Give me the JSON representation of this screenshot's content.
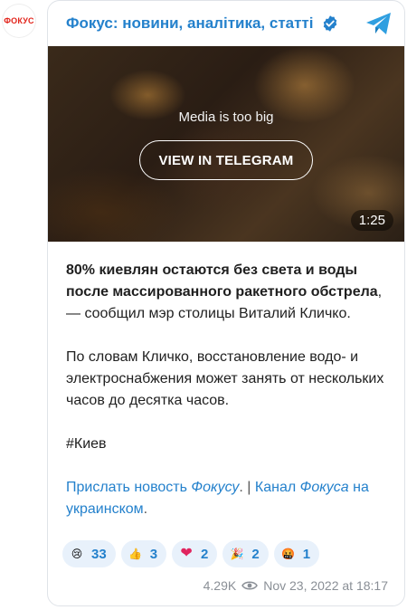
{
  "avatar": {
    "label": "ФОКУС"
  },
  "channel": {
    "title": "Фокус: новини, аналітика, статті",
    "verified_icon": "verified-badge-icon",
    "brand_icon": "telegram-icon",
    "accent": "#2481cc"
  },
  "media": {
    "notice": "Media is too big",
    "view_button": "VIEW IN TELEGRAM",
    "duration": "1:25"
  },
  "message": {
    "bold_lead": "80% киевлян остаются без света и воды после массированного ракетного обстрела",
    "lead_rest": ", — сообщил мэр столицы Виталий Кличко.",
    "paragraph2": "По словам Кличко, восстановление водо- и электроснабжения может занять от нескольких часов до десятка часов.",
    "hashtag": "#Киев",
    "link1_prefix": "Прислать новость ",
    "link1_italic": "Фокусу",
    "link1_dot": ".",
    "separator": " | ",
    "link2_prefix": "Канал ",
    "link2_italic": "Фокуса",
    "link2_suffix": " на украинском",
    "end_dot": "."
  },
  "reactions": [
    {
      "icon": "crying-face-icon",
      "glyph": "😢",
      "count": "33"
    },
    {
      "icon": "thumbs-up-icon",
      "glyph": "👍",
      "count": "3"
    },
    {
      "icon": "red-heart-icon",
      "glyph": "❤",
      "count": "2"
    },
    {
      "icon": "party-popper-icon",
      "glyph": "🎉",
      "count": "2"
    },
    {
      "icon": "angry-face-icon",
      "glyph": "🤬",
      "count": "1"
    }
  ],
  "footer": {
    "views": "4.29K",
    "views_icon": "eye-icon",
    "date": "Nov 23, 2022 at 18:17"
  }
}
